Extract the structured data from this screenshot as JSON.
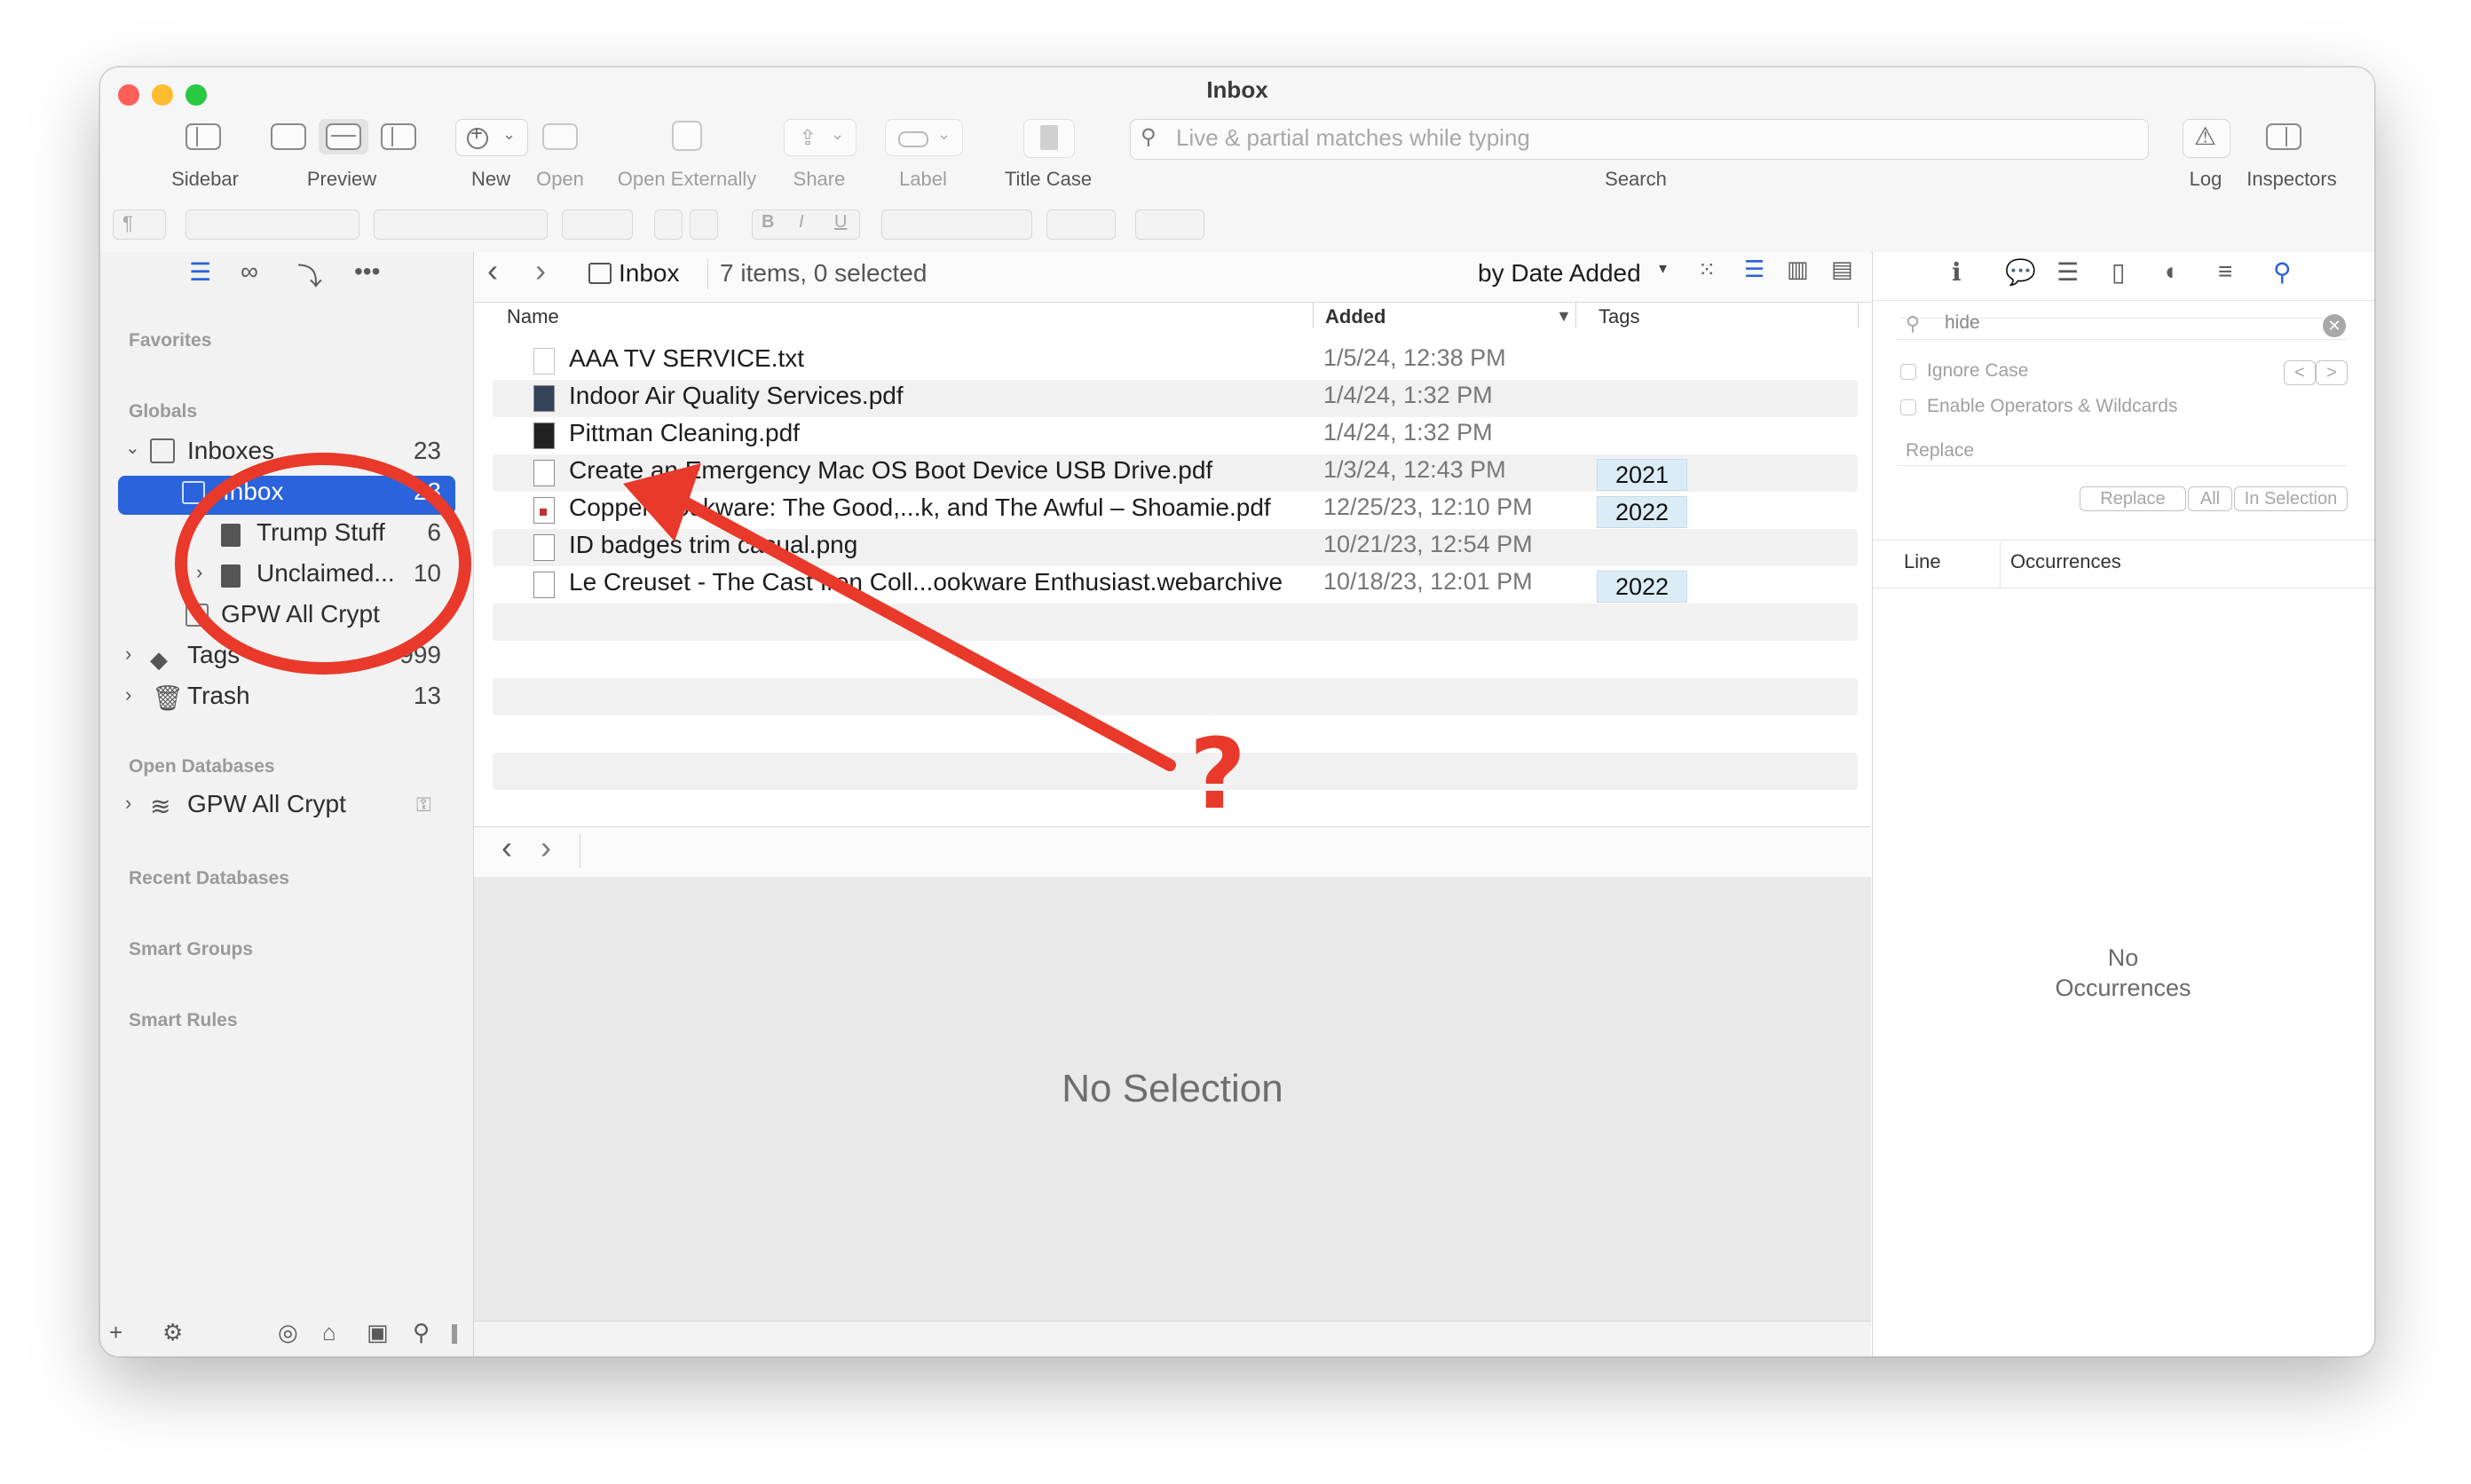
{
  "window": {
    "title": "Inbox"
  },
  "toolbar": {
    "sidebar_label": "Sidebar",
    "preview_label": "Preview",
    "new_label": "New",
    "open_label": "Open",
    "open_externally_label": "Open Externally",
    "share_label": "Share",
    "label_label": "Label",
    "title_case_label": "Title Case",
    "search_placeholder": "Live & partial matches while typing",
    "search_label": "Search",
    "log_label": "Log",
    "inspectors_label": "Inspectors",
    "format_bold": "B",
    "format_italic": "I",
    "format_underline": "U",
    "paragraph_symbol": "¶"
  },
  "sidebar": {
    "favorites": "Favorites",
    "globals": "Globals",
    "inboxes": {
      "label": "Inboxes",
      "count": "23"
    },
    "inbox": {
      "label": "Inbox",
      "count": "23"
    },
    "trump_stuff": {
      "label": "Trump Stuff",
      "count": "6"
    },
    "unclaimed": {
      "label": "Unclaimed...",
      "count": "10"
    },
    "gpw_all_crypt_inbox": {
      "label": "GPW All Crypt"
    },
    "tags": {
      "label": "Tags",
      "count": "999"
    },
    "trash": {
      "label": "Trash",
      "count": "13"
    },
    "open_databases": "Open Databases",
    "gpw_all_crypt_db": {
      "label": "GPW All Crypt"
    },
    "recent_databases": "Recent Databases",
    "smart_groups": "Smart Groups",
    "smart_rules": "Smart Rules"
  },
  "path": {
    "location": "Inbox",
    "status": "7 items, 0 selected",
    "sort": "by Date Added"
  },
  "columns": {
    "name": "Name",
    "added": "Added",
    "tags": "Tags"
  },
  "files": [
    {
      "name": "AAA TV SERVICE.txt",
      "added": "1/5/24, 12:38 PM",
      "tag": ""
    },
    {
      "name": "Indoor Air Quality Services.pdf",
      "added": "1/4/24, 1:32 PM",
      "tag": ""
    },
    {
      "name": "Pittman Cleaning.pdf",
      "added": "1/4/24, 1:32 PM",
      "tag": ""
    },
    {
      "name": "Create an Emergency Mac OS Boot Device USB Drive.pdf",
      "added": "1/3/24, 12:43 PM",
      "tag": "2021"
    },
    {
      "name": "Copper Cookware: The Good,...k, and The Awful – Shoamie.pdf",
      "added": "12/25/23, 12:10 PM",
      "tag": "2022"
    },
    {
      "name": "ID badges trim casual.png",
      "added": "10/21/23, 12:54 PM",
      "tag": ""
    },
    {
      "name": "Le Creuset - The Cast Iron Coll...ookware Enthusiast.webarchive",
      "added": "10/18/23, 12:01 PM",
      "tag": "2022"
    }
  ],
  "preview": {
    "empty": "No Selection"
  },
  "inspector": {
    "find_value": "hide",
    "ignore_case": "Ignore Case",
    "enable_operators": "Enable Operators & Wildcards",
    "replace_placeholder": "Replace",
    "replace_btn": "Replace",
    "all_btn": "All",
    "in_selection_btn": "In Selection",
    "prev_btn": "<",
    "next_btn": ">",
    "col_line": "Line",
    "col_occurrences": "Occurrences",
    "empty_line1": "No",
    "empty_line2": "Occurrences"
  },
  "annotation": {
    "mark": "?"
  },
  "colors": {
    "accent": "#2a63db",
    "annotation": "#e8392a",
    "tag_bg": "#dcecf7"
  }
}
